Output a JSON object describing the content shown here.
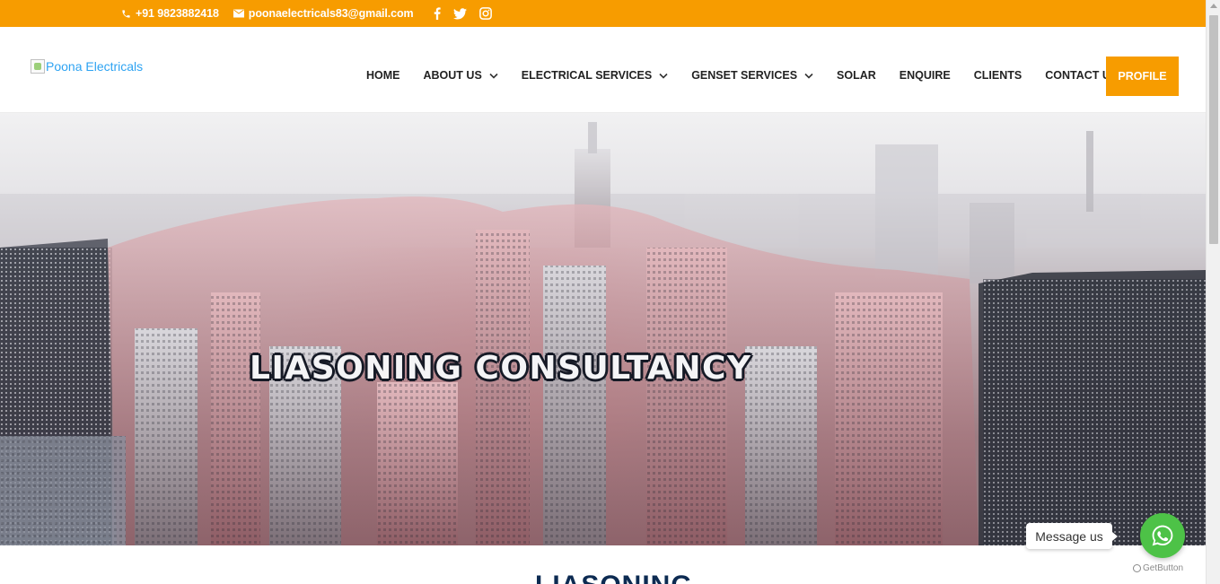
{
  "topbar": {
    "phone": "+91 9823882418",
    "email": "poonaelectricals83@gmail.com",
    "phone_icon": "phone-icon",
    "email_icon": "envelope-icon",
    "socials": [
      "facebook-icon",
      "twitter-icon",
      "instagram-icon"
    ]
  },
  "header": {
    "logo_alt": "Poona Electricals",
    "nav": [
      {
        "label": "HOME",
        "has_dropdown": false
      },
      {
        "label": "ABOUT US",
        "has_dropdown": true
      },
      {
        "label": "ELECTRICAL SERVICES",
        "has_dropdown": true
      },
      {
        "label": "GENSET SERVICES",
        "has_dropdown": true
      },
      {
        "label": "SOLAR",
        "has_dropdown": false
      },
      {
        "label": "ENQUIRE",
        "has_dropdown": false
      },
      {
        "label": "CLIENTS",
        "has_dropdown": false
      },
      {
        "label": "CONTACT US",
        "has_dropdown": false
      }
    ],
    "profile_label": "PROFILE"
  },
  "hero": {
    "title": "LIASONING CONSULTANCY"
  },
  "content": {
    "section_heading": "LIASONING"
  },
  "widget": {
    "message_label": "Message us",
    "brand": "GetButton"
  },
  "colors": {
    "accent": "#f79c00",
    "nav_text": "#222222",
    "heading": "#0d2b52",
    "whatsapp": "#4dc247"
  }
}
